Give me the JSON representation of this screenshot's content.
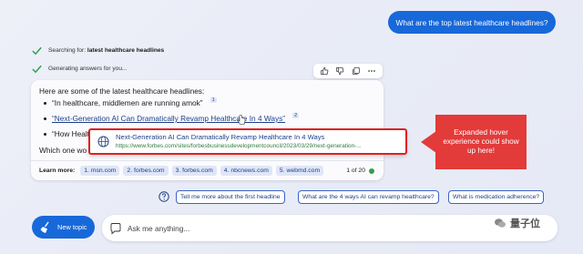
{
  "user_query": "What are the top latest healthcare headlines?",
  "status": [
    {
      "prefix": "Searching for: ",
      "bold": "latest healthcare headlines"
    },
    {
      "prefix": "Generating answers for you...",
      "bold": ""
    }
  ],
  "answer": {
    "intro": "Here are some of the latest healthcare headlines:",
    "items": [
      {
        "text": "“In healthcare, middlemen are running amok”",
        "cite": "1"
      },
      {
        "text": "“Next-Generation AI Can Dramatically Revamp Healthcare In 4 Ways”",
        "cite": "2"
      },
      {
        "text": "“How Healt",
        "cite": ""
      }
    ],
    "which": "Which one wo"
  },
  "learn_more": {
    "label": "Learn more:",
    "sources": [
      "1. msn.com",
      "2. forbes.com",
      "3. forbes.com",
      "4. nbcnews.com",
      "5. webmd.com"
    ],
    "count": "1 of 20"
  },
  "hover": {
    "title": "Next-Generation AI Can Dramatically Revamp Healthcare In 4 Ways",
    "url": "https://www.forbes.com/sites/forbesbusinessdevelopmentcouncil/2023/03/29/next-generation-..."
  },
  "callout": "Expanded hover experience could show up here!",
  "suggestions": [
    "Tell me more about the first headline",
    "What are the 4 ways AI can revamp healthcare?",
    "What is medication adherence?"
  ],
  "new_topic": "New topic",
  "ask_placeholder": "Ask me anything...",
  "watermark": "量子位",
  "colors": {
    "accent": "#1768d9",
    "callout": "#e33a3a",
    "url": "#2f7a3b",
    "link": "#1d3f86"
  }
}
